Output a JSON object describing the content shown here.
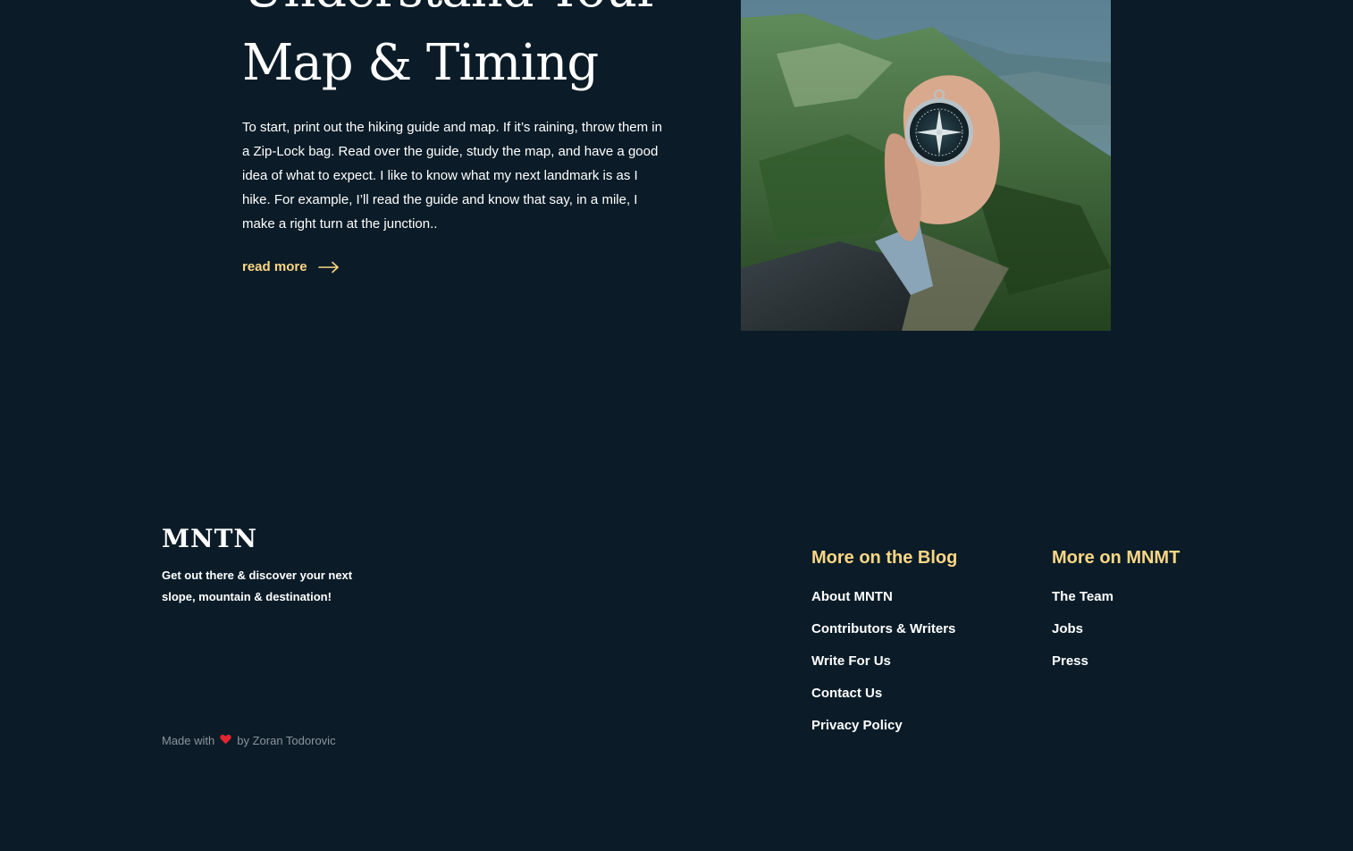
{
  "article": {
    "title_line1": "Understand Your",
    "title_line2": "Map & Timing",
    "body": "To start, print out the hiking guide and map. If it’s raining, throw them in a Zip-Lock bag. Read over the guide, study the map, and have a good idea of what to expect. I like to know what my next landmark is as I hike. For example, I’ll read the guide and know that say, in a mile, I make a right turn at the junction..",
    "read_more_label": "read more",
    "read_more_icon": "arrow-right-icon",
    "photo_icon": "compass-hand-photo"
  },
  "footer": {
    "logo": "MNTN",
    "tagline": "Get out there & discover your next slope, mountain & destination!",
    "credit_prefix": "Made with",
    "credit_icon": "heart-icon",
    "credit_suffix": "by Zoran Todorovic",
    "columns": [
      {
        "heading": "More on the Blog",
        "links": [
          "About MNTN",
          "Contributors & Writers",
          "Write For Us",
          "Contact Us",
          "Privacy Policy"
        ]
      },
      {
        "heading": "More on MNMT",
        "links": [
          "The Team",
          "Jobs",
          "Press"
        ]
      }
    ]
  },
  "colors": {
    "background": "#0b1c28",
    "accent": "#fbd784",
    "text": "#ffffff",
    "muted": "#8a949c",
    "heart": "#e3262f"
  }
}
